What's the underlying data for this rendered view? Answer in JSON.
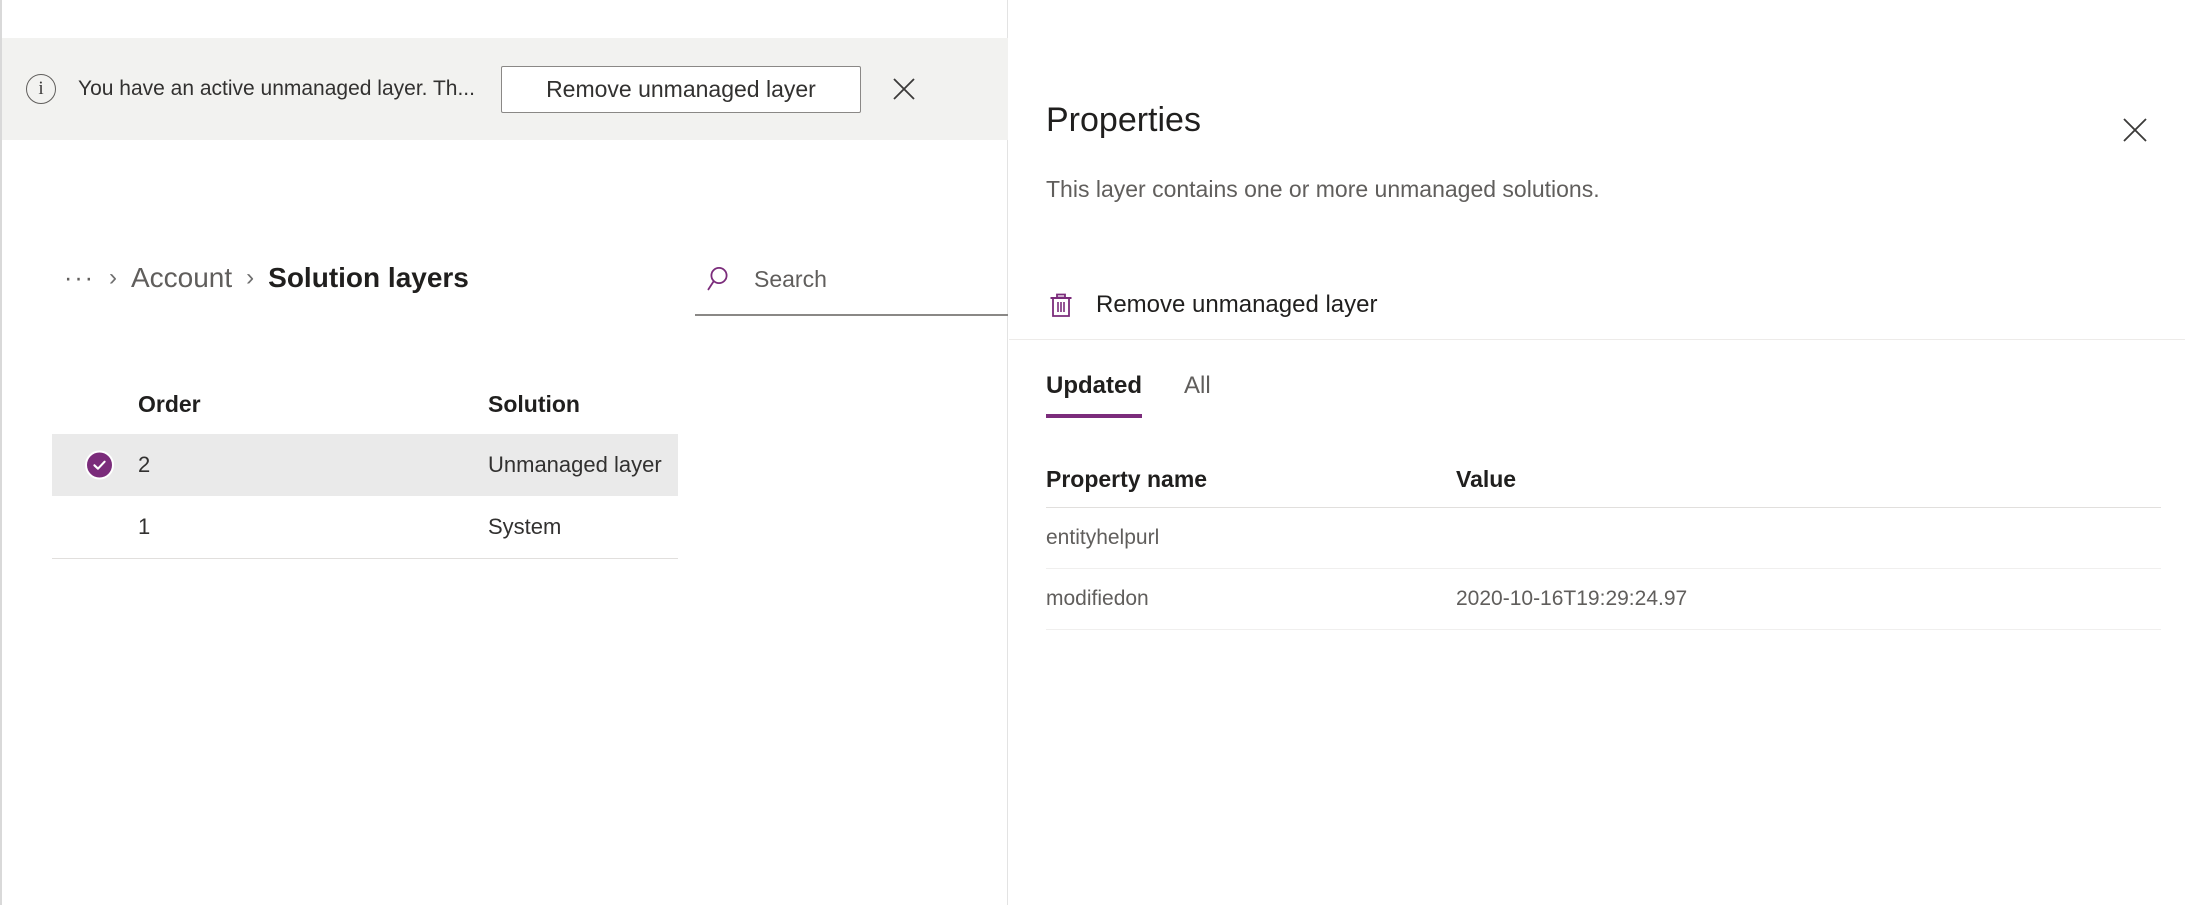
{
  "notification": {
    "icon": "info-circle-icon",
    "message": "You have an active unmanaged layer. Th...",
    "action_label": "Remove unmanaged layer",
    "close_icon": "close-icon"
  },
  "breadcrumb": {
    "ellipsis": "···",
    "separator": "›",
    "parent": "Account",
    "current": "Solution layers"
  },
  "search": {
    "icon": "search-icon",
    "placeholder": "Search",
    "value": ""
  },
  "layers_table": {
    "columns": {
      "order": "Order",
      "solution": "Solution"
    },
    "rows": [
      {
        "order": "2",
        "solution": "Unmanaged layer",
        "selected": true
      },
      {
        "order": "1",
        "solution": "System",
        "selected": false
      }
    ]
  },
  "properties_panel": {
    "title": "Properties",
    "subtitle": "This layer contains one or more unmanaged solutions.",
    "close_icon": "close-icon",
    "command": {
      "icon": "trash-icon",
      "label": "Remove unmanaged layer"
    },
    "tabs": [
      {
        "label": "Updated",
        "active": true
      },
      {
        "label": "All",
        "active": false
      }
    ],
    "table": {
      "columns": {
        "property_name": "Property name",
        "value": "Value"
      },
      "rows": [
        {
          "property_name": "entityhelpurl",
          "value": ""
        },
        {
          "property_name": "modifiedon",
          "value": "2020-10-16T19:29:24.97"
        }
      ]
    }
  },
  "colors": {
    "accent": "#7b2c7b",
    "notification_bg": "#f2f2f0",
    "selected_row_bg": "#eaeaea",
    "text_primary": "#201f1e",
    "text_secondary": "#605e5c"
  }
}
